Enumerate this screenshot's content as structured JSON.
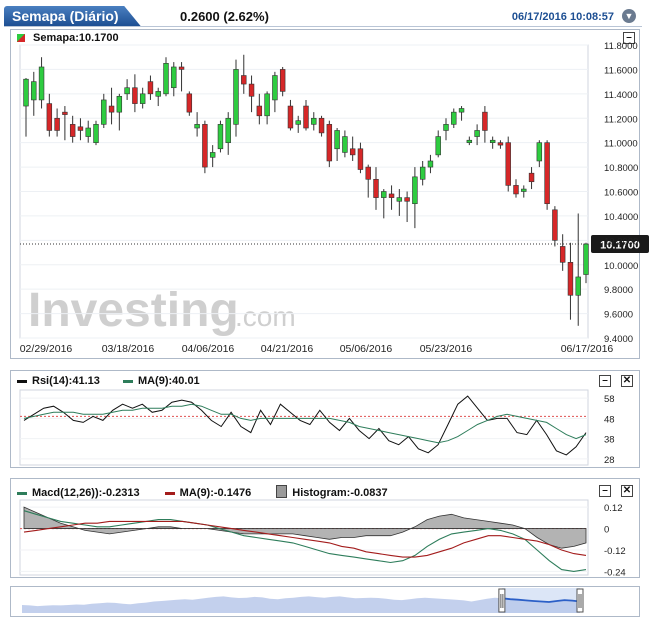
{
  "header": {
    "title": "Semapa (Diário)",
    "price_change": "0.2600 (2.62%)",
    "datetime": "06/17/2016 10:08:57",
    "info_icon": "chevron-down-icon"
  },
  "main_panel": {
    "legend": "Semapa:10.1700",
    "last_price_label": "10.1700",
    "watermark": "Investing",
    "watermark_suffix": ".com",
    "minimize_label": "–"
  },
  "rsi_panel": {
    "rsi_legend": "Rsi(14):41.13",
    "ma_legend": "MA(9):40.01",
    "minimize_label": "–",
    "close_label": "✕"
  },
  "macd_panel": {
    "macd_legend": "Macd(12,26)):-0.2313",
    "ma_legend": "MA(9):-0.1476",
    "hist_legend": "Histogram:-0.0837",
    "minimize_label": "–",
    "close_label": "✕"
  },
  "colors": {
    "up": "#2ecc40",
    "down": "#d62728",
    "rsi": "#111111",
    "ma": "#2e7d5b",
    "macd": "#2e7d5b",
    "macd_signal": "#a31c1c",
    "hist": "#9a9a9a",
    "navigator": "#2b5fc7"
  },
  "chart_data": [
    {
      "type": "candlestick",
      "title": "Semapa (Diário)",
      "ylim": [
        9.4,
        11.8
      ],
      "yticks": [
        "11.8000",
        "11.6000",
        "11.4000",
        "11.2000",
        "11.0000",
        "10.8000",
        "10.6000",
        "10.4000",
        "10.2000",
        "10.0000",
        "9.8000",
        "9.6000",
        "9.4000"
      ],
      "xticks": [
        "02/29/2016",
        "03/18/2016",
        "04/06/2016",
        "04/21/2016",
        "05/06/2016",
        "05/23/2016",
        "06/17/2016"
      ],
      "candles": [
        {
          "o": 11.3,
          "h": 11.53,
          "l": 11.05,
          "c": 11.52
        },
        {
          "o": 11.35,
          "h": 11.58,
          "l": 11.22,
          "c": 11.5
        },
        {
          "o": 11.35,
          "h": 11.7,
          "l": 11.28,
          "c": 11.62
        },
        {
          "o": 11.32,
          "h": 11.4,
          "l": 11.05,
          "c": 11.1
        },
        {
          "o": 11.2,
          "h": 11.28,
          "l": 11.05,
          "c": 11.1
        },
        {
          "o": 11.25,
          "h": 11.3,
          "l": 11.02,
          "c": 11.23
        },
        {
          "o": 11.15,
          "h": 11.22,
          "l": 11.0,
          "c": 11.05
        },
        {
          "o": 11.13,
          "h": 11.2,
          "l": 11.02,
          "c": 11.1
        },
        {
          "o": 11.05,
          "h": 11.18,
          "l": 11.0,
          "c": 11.12
        },
        {
          "o": 11.0,
          "h": 11.18,
          "l": 10.98,
          "c": 11.15
        },
        {
          "o": 11.15,
          "h": 11.4,
          "l": 11.12,
          "c": 11.35
        },
        {
          "o": 11.3,
          "h": 11.45,
          "l": 11.15,
          "c": 11.25
        },
        {
          "o": 11.25,
          "h": 11.4,
          "l": 11.1,
          "c": 11.38
        },
        {
          "o": 11.4,
          "h": 11.52,
          "l": 11.35,
          "c": 11.45
        },
        {
          "o": 11.45,
          "h": 11.56,
          "l": 11.25,
          "c": 11.32
        },
        {
          "o": 11.32,
          "h": 11.45,
          "l": 11.28,
          "c": 11.4
        },
        {
          "o": 11.5,
          "h": 11.55,
          "l": 11.35,
          "c": 11.4
        },
        {
          "o": 11.38,
          "h": 11.45,
          "l": 11.3,
          "c": 11.42
        },
        {
          "o": 11.4,
          "h": 11.7,
          "l": 11.38,
          "c": 11.65
        },
        {
          "o": 11.45,
          "h": 11.66,
          "l": 11.38,
          "c": 11.62
        },
        {
          "o": 11.62,
          "h": 11.66,
          "l": 11.42,
          "c": 11.6
        },
        {
          "o": 11.4,
          "h": 11.42,
          "l": 11.22,
          "c": 11.25
        },
        {
          "o": 11.12,
          "h": 11.25,
          "l": 11.05,
          "c": 11.15
        },
        {
          "o": 11.15,
          "h": 11.18,
          "l": 10.75,
          "c": 10.8
        },
        {
          "o": 10.88,
          "h": 10.98,
          "l": 10.8,
          "c": 10.92
        },
        {
          "o": 10.95,
          "h": 11.18,
          "l": 10.92,
          "c": 11.15
        },
        {
          "o": 11.0,
          "h": 11.25,
          "l": 10.9,
          "c": 11.2
        },
        {
          "o": 11.15,
          "h": 11.68,
          "l": 11.05,
          "c": 11.6
        },
        {
          "o": 11.55,
          "h": 11.72,
          "l": 11.4,
          "c": 11.48
        },
        {
          "o": 11.48,
          "h": 11.55,
          "l": 11.25,
          "c": 11.38
        },
        {
          "o": 11.3,
          "h": 11.4,
          "l": 11.15,
          "c": 11.22
        },
        {
          "o": 11.22,
          "h": 11.42,
          "l": 11.15,
          "c": 11.4
        },
        {
          "o": 11.35,
          "h": 11.58,
          "l": 11.25,
          "c": 11.55
        },
        {
          "o": 11.6,
          "h": 11.62,
          "l": 11.38,
          "c": 11.42
        },
        {
          "o": 11.3,
          "h": 11.35,
          "l": 11.1,
          "c": 11.12
        },
        {
          "o": 11.15,
          "h": 11.22,
          "l": 11.08,
          "c": 11.18
        },
        {
          "o": 11.3,
          "h": 11.35,
          "l": 11.1,
          "c": 11.12
        },
        {
          "o": 11.15,
          "h": 11.25,
          "l": 11.1,
          "c": 11.2
        },
        {
          "o": 11.2,
          "h": 11.22,
          "l": 11.05,
          "c": 11.08
        },
        {
          "o": 11.15,
          "h": 11.18,
          "l": 10.8,
          "c": 10.85
        },
        {
          "o": 10.95,
          "h": 11.12,
          "l": 10.85,
          "c": 11.1
        },
        {
          "o": 10.92,
          "h": 11.1,
          "l": 10.88,
          "c": 11.05
        },
        {
          "o": 10.95,
          "h": 11.05,
          "l": 10.85,
          "c": 10.9
        },
        {
          "o": 10.95,
          "h": 11.0,
          "l": 10.75,
          "c": 10.78
        },
        {
          "o": 10.8,
          "h": 10.82,
          "l": 10.55,
          "c": 10.7
        },
        {
          "o": 10.7,
          "h": 10.8,
          "l": 10.45,
          "c": 10.55
        },
        {
          "o": 10.55,
          "h": 10.62,
          "l": 10.38,
          "c": 10.6
        },
        {
          "o": 10.58,
          "h": 10.65,
          "l": 10.45,
          "c": 10.55
        },
        {
          "o": 10.52,
          "h": 10.62,
          "l": 10.4,
          "c": 10.55
        },
        {
          "o": 10.55,
          "h": 10.6,
          "l": 10.35,
          "c": 10.52
        },
        {
          "o": 10.5,
          "h": 10.8,
          "l": 10.3,
          "c": 10.72
        },
        {
          "o": 10.7,
          "h": 10.85,
          "l": 10.65,
          "c": 10.8
        },
        {
          "o": 10.8,
          "h": 10.9,
          "l": 10.75,
          "c": 10.85
        },
        {
          "o": 10.9,
          "h": 11.1,
          "l": 10.88,
          "c": 11.05
        },
        {
          "o": 11.1,
          "h": 11.2,
          "l": 11.02,
          "c": 11.15
        },
        {
          "o": 11.15,
          "h": 11.28,
          "l": 11.12,
          "c": 11.25
        },
        {
          "o": 11.25,
          "h": 11.3,
          "l": 11.18,
          "c": 11.28
        },
        {
          "o": 11.0,
          "h": 11.05,
          "l": 10.98,
          "c": 11.02
        },
        {
          "o": 11.05,
          "h": 11.15,
          "l": 10.98,
          "c": 11.1
        },
        {
          "o": 11.25,
          "h": 11.3,
          "l": 11.0,
          "c": 11.1
        },
        {
          "o": 11.0,
          "h": 11.05,
          "l": 10.95,
          "c": 11.02
        },
        {
          "o": 11.0,
          "h": 11.02,
          "l": 10.95,
          "c": 10.98
        },
        {
          "o": 11.0,
          "h": 11.05,
          "l": 10.6,
          "c": 10.65
        },
        {
          "o": 10.65,
          "h": 10.7,
          "l": 10.55,
          "c": 10.58
        },
        {
          "o": 10.6,
          "h": 10.65,
          "l": 10.55,
          "c": 10.62
        },
        {
          "o": 10.75,
          "h": 10.8,
          "l": 10.62,
          "c": 10.68
        },
        {
          "o": 10.85,
          "h": 11.02,
          "l": 10.8,
          "c": 11.0
        },
        {
          "o": 11.0,
          "h": 11.02,
          "l": 10.45,
          "c": 10.5
        },
        {
          "o": 10.45,
          "h": 10.48,
          "l": 10.15,
          "c": 10.2
        },
        {
          "o": 10.15,
          "h": 10.25,
          "l": 9.95,
          "c": 10.02
        },
        {
          "o": 10.02,
          "h": 10.18,
          "l": 9.55,
          "c": 9.75
        },
        {
          "o": 9.75,
          "h": 10.42,
          "l": 9.5,
          "c": 9.9
        },
        {
          "o": 9.92,
          "h": 10.18,
          "l": 9.85,
          "c": 10.17
        }
      ],
      "last_price": 10.17
    },
    {
      "type": "line",
      "title": "Rsi(14)",
      "ylim": [
        25,
        62
      ],
      "yticks": [
        58,
        48,
        38,
        28
      ],
      "reference": 49,
      "series": [
        {
          "name": "Rsi(14)",
          "values": [
            47,
            50,
            53,
            54,
            51,
            47,
            46,
            49,
            47,
            52,
            55,
            53,
            55,
            51,
            52,
            56,
            57,
            56,
            52,
            47,
            44,
            51,
            44,
            41,
            52,
            45,
            55,
            51,
            47,
            45,
            52,
            46,
            42,
            48,
            42,
            38,
            43,
            37,
            35,
            39,
            33,
            31,
            35,
            45,
            55,
            59,
            53,
            47,
            48,
            48,
            41,
            40,
            47,
            40,
            32,
            30,
            34,
            41
          ]
        },
        {
          "name": "MA(9)",
          "values": [
            48,
            49,
            50,
            51,
            51,
            51,
            50,
            50,
            50,
            51,
            52,
            52,
            53,
            53,
            53,
            54,
            54,
            55,
            54,
            52,
            50,
            50,
            48,
            47,
            48,
            48,
            48,
            48,
            48,
            48,
            48,
            48,
            47,
            46,
            44,
            43,
            42,
            41,
            40,
            39,
            38,
            37,
            36,
            37,
            39,
            42,
            45,
            47,
            49,
            50,
            49,
            48,
            47,
            46,
            43,
            40,
            38,
            40
          ]
        }
      ]
    },
    {
      "type": "line",
      "title": "Macd(12,26)",
      "ylim": [
        -0.26,
        0.16
      ],
      "yticks": [
        0.12,
        0,
        -0.12,
        -0.24
      ],
      "series": [
        {
          "name": "Macd(12,26)",
          "values": [
            0.1,
            0.08,
            0.06,
            0.04,
            0.03,
            0.02,
            0.01,
            0.01,
            0.02,
            0.03,
            0.04,
            0.05,
            0.05,
            0.04,
            0.03,
            0.02,
            0.0,
            -0.02,
            -0.04,
            -0.05,
            -0.06,
            -0.07,
            -0.08,
            -0.1,
            -0.12,
            -0.14,
            -0.15,
            -0.16,
            -0.17,
            -0.18,
            -0.19,
            -0.18,
            -0.15,
            -0.1,
            -0.06,
            -0.03,
            -0.02,
            -0.01,
            0.0,
            -0.01,
            -0.03,
            -0.06,
            -0.12,
            -0.18,
            -0.23,
            -0.24,
            -0.23
          ]
        },
        {
          "name": "MA(9)",
          "values": [
            -0.02,
            -0.01,
            0.0,
            0.01,
            0.02,
            0.03,
            0.03,
            0.04,
            0.04,
            0.04,
            0.04,
            0.04,
            0.04,
            0.04,
            0.03,
            0.02,
            0.01,
            0.0,
            -0.01,
            -0.02,
            -0.03,
            -0.04,
            -0.05,
            -0.06,
            -0.07,
            -0.08,
            -0.1,
            -0.11,
            -0.13,
            -0.14,
            -0.15,
            -0.16,
            -0.16,
            -0.15,
            -0.13,
            -0.11,
            -0.08,
            -0.06,
            -0.04,
            -0.04,
            -0.05,
            -0.06,
            -0.07,
            -0.09,
            -0.12,
            -0.14,
            -0.15
          ]
        },
        {
          "name": "Histogram",
          "values": [
            0.12,
            0.09,
            0.06,
            0.03,
            0.01,
            -0.01,
            -0.02,
            -0.03,
            -0.02,
            -0.01,
            0.0,
            0.01,
            0.01,
            0.0,
            0.0,
            0.0,
            -0.01,
            -0.02,
            -0.03,
            -0.03,
            -0.03,
            -0.03,
            -0.03,
            -0.04,
            -0.05,
            -0.06,
            -0.05,
            -0.05,
            -0.04,
            -0.04,
            -0.04,
            -0.02,
            0.01,
            0.05,
            0.07,
            0.08,
            0.06,
            0.05,
            0.04,
            0.03,
            0.02,
            0.0,
            -0.05,
            -0.09,
            -0.11,
            -0.1,
            -0.08
          ]
        }
      ]
    },
    {
      "type": "area",
      "title": "",
      "series": [
        {
          "name": "navigator",
          "values": [
            0.35,
            0.33,
            0.3,
            0.32,
            0.34,
            0.33,
            0.35,
            0.37,
            0.36,
            0.4,
            0.42,
            0.45,
            0.44,
            0.4,
            0.38,
            0.42,
            0.45,
            0.5,
            0.52,
            0.55,
            0.58,
            0.6,
            0.58,
            0.62,
            0.66,
            0.7,
            0.72,
            0.68,
            0.65,
            0.66,
            0.7,
            0.68,
            0.62,
            0.6,
            0.64,
            0.66,
            0.7,
            0.72,
            0.69,
            0.66,
            0.7,
            0.72,
            0.68,
            0.64,
            0.65,
            0.66,
            0.65,
            0.62,
            0.58,
            0.56,
            0.6,
            0.64,
            0.66,
            0.64,
            0.62,
            0.6,
            0.58,
            0.55,
            0.5,
            0.56,
            0.62,
            0.66,
            0.64,
            0.6,
            0.58,
            0.55,
            0.52,
            0.5,
            0.48,
            0.52,
            0.56,
            0.54,
            0.5
          ]
        }
      ]
    }
  ]
}
